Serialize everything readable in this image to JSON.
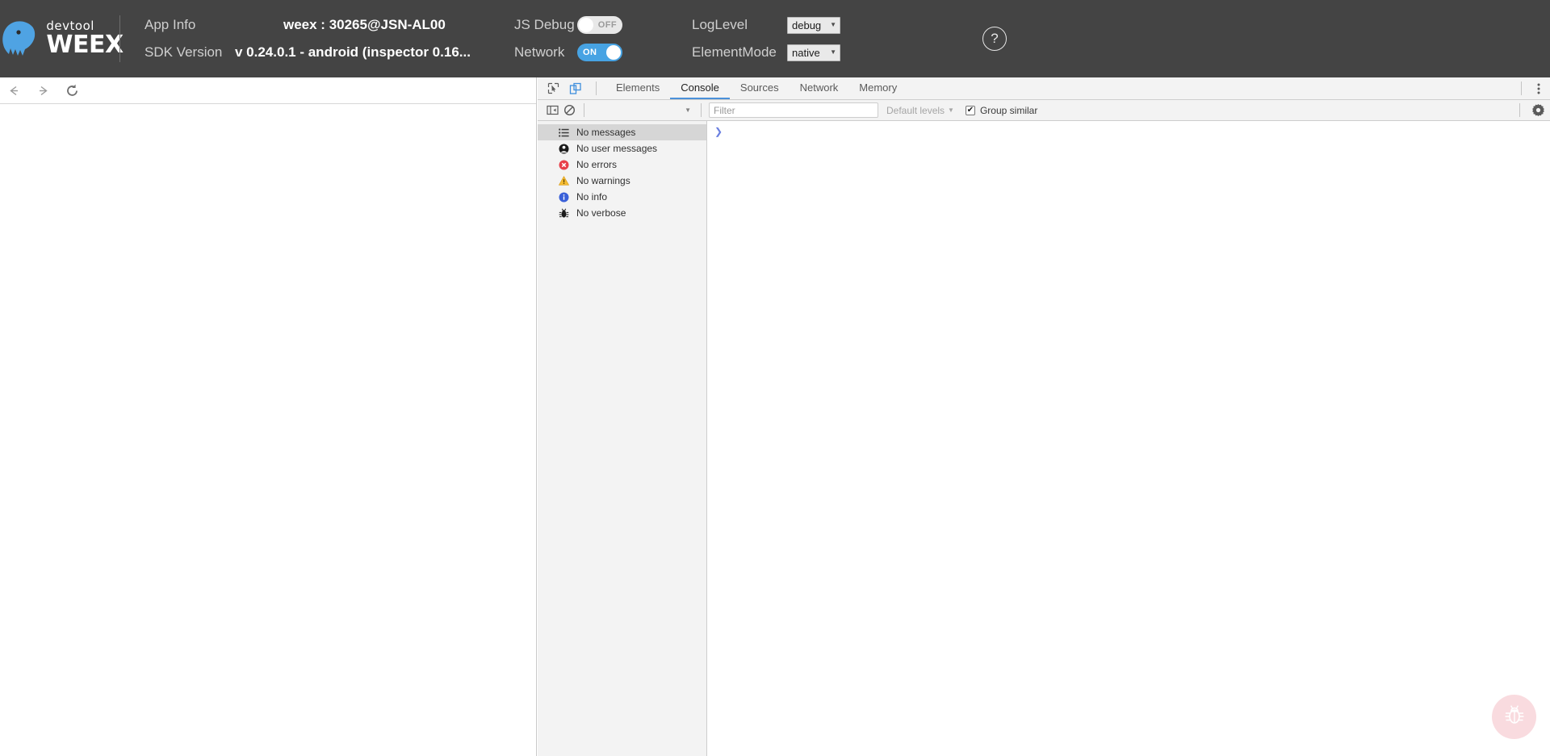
{
  "header": {
    "brand": {
      "top": "devtool",
      "bottom": "WEEX",
      "logo_icon": "weex-bird-logo"
    },
    "app_info": {
      "label": "App Info",
      "value": "weex : 30265@JSN-AL00"
    },
    "sdk_version": {
      "label": "SDK Version",
      "value": "v 0.24.0.1 - android (inspector 0.16..."
    },
    "js_debug": {
      "label": "JS Debug",
      "state": "OFF",
      "on": false
    },
    "network": {
      "label": "Network",
      "state": "ON",
      "on": true
    },
    "log_level": {
      "label": "LogLevel",
      "value": "debug"
    },
    "element_mode": {
      "label": "ElementMode",
      "value": "native"
    },
    "help": {
      "label": "?",
      "icon": "question-mark-icon"
    },
    "colors": {
      "background": "#444444",
      "toggle_on": "#47a3e3",
      "toggle_off": "#e8e8e8",
      "label_text": "#cfcfcf",
      "value_text": "#ffffff"
    }
  },
  "page_pane": {
    "nav": {
      "back": "back-arrow-icon",
      "forward": "forward-arrow-icon",
      "reload": "reload-icon"
    }
  },
  "devtools": {
    "toolbar_icons": {
      "inspect": "inspect-element-icon",
      "device": "device-toolbar-icon",
      "kebab": "more-options-icon"
    },
    "tabs": [
      {
        "label": "Elements",
        "active": false
      },
      {
        "label": "Console",
        "active": true
      },
      {
        "label": "Sources",
        "active": false
      },
      {
        "label": "Network",
        "active": false
      },
      {
        "label": "Memory",
        "active": false
      }
    ],
    "console_toolbar": {
      "sidebar_toggle_icon": "console-sidebar-toggle-icon",
      "clear_icon": "clear-console-icon",
      "context_selector": {
        "value": "",
        "caret": "▼"
      },
      "filter": {
        "value": "",
        "placeholder": "Filter"
      },
      "levels": {
        "label": "Default levels",
        "caret": "▼"
      },
      "group_similar": {
        "label": "Group similar",
        "checked": true,
        "mark": "✔"
      },
      "settings_icon": "gear-icon"
    },
    "console_sidebar": [
      {
        "label": "No messages",
        "icon": "list-icon",
        "selected": true
      },
      {
        "label": "No user messages",
        "icon": "user-icon",
        "selected": false
      },
      {
        "label": "No errors",
        "icon": "error-icon",
        "selected": false
      },
      {
        "label": "No warnings",
        "icon": "warning-icon",
        "selected": false
      },
      {
        "label": "No info",
        "icon": "info-icon",
        "selected": false
      },
      {
        "label": "No verbose",
        "icon": "verbose-icon",
        "selected": false
      }
    ],
    "console_prompt": {
      "caret": "❯",
      "value": ""
    },
    "fab": {
      "icon": "bug-icon",
      "color": "#f0a0aa"
    },
    "accent_color": "#4a90d9"
  }
}
